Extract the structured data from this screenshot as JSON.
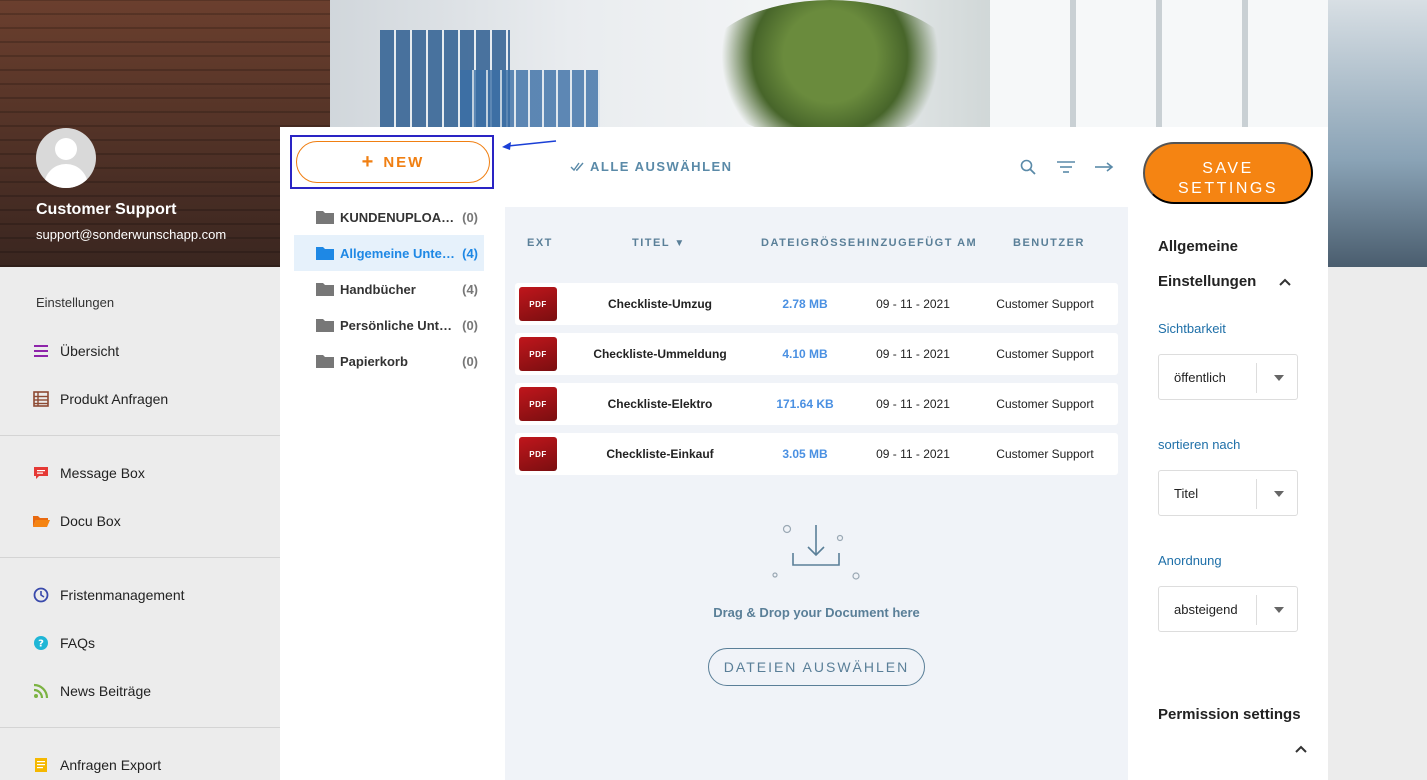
{
  "profile": {
    "name": "Customer Support",
    "email": "support@sonderwunschapp.com"
  },
  "sidebar": {
    "section_label": "Einstellungen",
    "items": [
      {
        "label": "Übersicht",
        "icon": "list-icon"
      },
      {
        "label": "Produkt Anfragen",
        "icon": "table-icon"
      },
      {
        "label": "Message Box",
        "icon": "chat-icon"
      },
      {
        "label": "Docu Box",
        "icon": "folder-open-icon"
      },
      {
        "label": "Fristenmanagement",
        "icon": "clock-icon"
      },
      {
        "label": "FAQs",
        "icon": "help-icon"
      },
      {
        "label": "News Beiträge",
        "icon": "rss-icon"
      },
      {
        "label": "Anfragen Export",
        "icon": "document-icon"
      }
    ]
  },
  "toolbar": {
    "new_label": "NEW",
    "select_all_label": "ALLE AUSWÄHLEN",
    "save_label_1": "SAVE",
    "save_label_2": "SETTINGS"
  },
  "folders": [
    {
      "name": "KUNDENUPLOADS",
      "count": "(0)",
      "active": false
    },
    {
      "name": "Allgemeine Unterlagen",
      "count": "(4)",
      "active": true
    },
    {
      "name": "Handbücher",
      "count": "(4)",
      "active": false
    },
    {
      "name": "Persönliche Unterlagen",
      "count": "(0)",
      "active": false
    },
    {
      "name": "Papierkorb",
      "count": "(0)",
      "active": false
    }
  ],
  "table": {
    "headers": {
      "ext": "EXT",
      "title": "TITEL",
      "size": "DATEIGRÖSSE",
      "date": "HINZUGEFÜGT AM",
      "user": "BENUTZER"
    },
    "ext_badge": "PDF",
    "rows": [
      {
        "title": "Checkliste-Umzug",
        "size": "2.78 MB",
        "date": "09 - 11 - 2021",
        "user": "Customer Support"
      },
      {
        "title": "Checkliste-Ummeldung",
        "size": "4.10 MB",
        "date": "09 - 11 - 2021",
        "user": "Customer Support"
      },
      {
        "title": "Checkliste-Elektro",
        "size": "171.64 KB",
        "date": "09 - 11 - 2021",
        "user": "Customer Support"
      },
      {
        "title": "Checkliste-Einkauf",
        "size": "3.05 MB",
        "date": "09 - 11 - 2021",
        "user": "Customer Support"
      }
    ]
  },
  "dropzone": {
    "text": "Drag & Drop your Document here",
    "button_label": "DATEIEN AUSWÄHLEN"
  },
  "settings": {
    "general_title_1": "Allgemeine",
    "general_title_2": "Einstellungen",
    "visibility_label": "Sichtbarkeit",
    "visibility_value": "öffentlich",
    "sort_label": "sortieren nach",
    "sort_value": "Titel",
    "order_label": "Anordnung",
    "order_value": "absteigend",
    "permission_title": "Permission settings"
  },
  "colors": {
    "accent_orange": "#f58412",
    "link_blue": "#1e88e5",
    "annotation_border": "#2a24c4"
  }
}
